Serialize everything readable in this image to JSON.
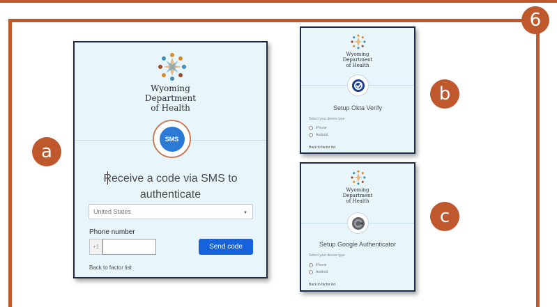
{
  "badges": {
    "main": "6",
    "a": "a",
    "b": "b",
    "c": "c"
  },
  "organization": {
    "line1": "Wyoming",
    "line2": "Department",
    "line3": "of Health"
  },
  "sms_card": {
    "icon_label": "SMS",
    "title_line1": "Receive a code via SMS to",
    "title_line2": "authenticate",
    "country_select": "United States",
    "phone_label": "Phone number",
    "country_code": "+1",
    "phone_value": "",
    "send_button": "Send code",
    "back_link": "Back to factor list"
  },
  "okta_card": {
    "title": "Setup Okta Verify",
    "subtitle": "Select your device type",
    "options": [
      "iPhone",
      "Android"
    ],
    "back_link": "Back to factor list"
  },
  "google_card": {
    "title": "Setup Google Authenticator",
    "subtitle": "Select your device type",
    "options": [
      "iPhone",
      "Android"
    ],
    "back_link": "Back to factor list"
  },
  "colors": {
    "accent": "#c0582e",
    "card_bg": "#e8f6fb",
    "button": "#1662dd",
    "card_border": "#1d2a45"
  },
  "icons": {
    "logo": "wyoming-health-logo",
    "sms": "sms-bubble-icon",
    "okta": "okta-verify-icon",
    "google": "google-authenticator-icon"
  }
}
